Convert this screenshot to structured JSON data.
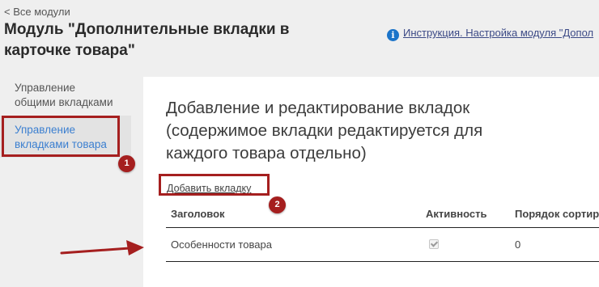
{
  "header": {
    "back_link": "< Все модули",
    "title": "Модуль \"Дополнительные вкладки в карточке товара\"",
    "help_link": "Инструкция. Настройка модуля \"Допол"
  },
  "sidebar": {
    "items": [
      {
        "label": "Управление общими вкладками",
        "active": false
      },
      {
        "label": "Управление вкладками товара",
        "active": true
      }
    ]
  },
  "main": {
    "title": "Добавление и редактирование вкладок (содержимое вкладки редактируется для каждого товара отдельно)",
    "add_tab_link": "Добавить вкладку",
    "table": {
      "columns": [
        "Заголовок",
        "Активность",
        "Порядок сортир"
      ],
      "rows": [
        {
          "title": "Особенности товара",
          "active": true,
          "sort": "0"
        }
      ]
    }
  },
  "annotations": {
    "badges": [
      "1",
      "2"
    ],
    "color": "#a51f1f"
  },
  "colors": {
    "accent_link": "#3b7fd0",
    "info_icon": "#1b74c9"
  }
}
